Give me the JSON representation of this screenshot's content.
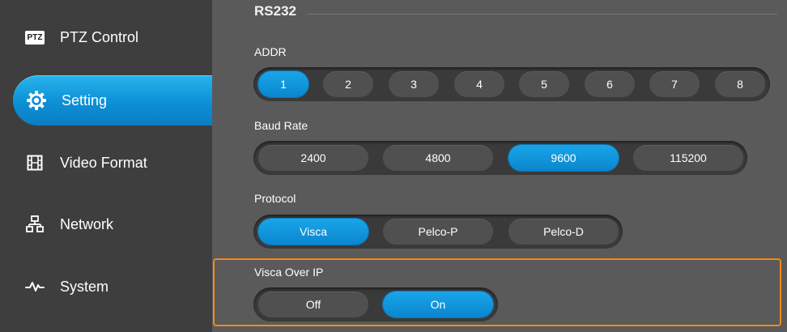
{
  "sidebar": {
    "items": [
      {
        "label": "PTZ Control",
        "icon": "ptz-icon",
        "badge": "PTZ"
      },
      {
        "label": "Setting",
        "icon": "gear-icon"
      },
      {
        "label": "Video Format",
        "icon": "film-icon"
      },
      {
        "label": "Network",
        "icon": "network-icon"
      },
      {
        "label": "System",
        "icon": "pulse-icon"
      }
    ],
    "active": "Setting"
  },
  "main": {
    "section_title": "RS232",
    "addr": {
      "label": "ADDR",
      "options": [
        "1",
        "2",
        "3",
        "4",
        "5",
        "6",
        "7",
        "8"
      ],
      "selected": "1"
    },
    "baud": {
      "label": "Baud Rate",
      "options": [
        "2400",
        "4800",
        "9600",
        "115200"
      ],
      "selected": "9600"
    },
    "protocol": {
      "label": "Protocol",
      "options": [
        "Visca",
        "Pelco-P",
        "Pelco-D"
      ],
      "selected": "Visca"
    },
    "visca_over_ip": {
      "label": "Visca Over IP",
      "options": [
        "Off",
        "On"
      ],
      "selected": "On"
    }
  },
  "colors": {
    "accent": "#0d8fd6",
    "sidebar_bg": "#3e3e3e",
    "content_bg": "#5a5a5a",
    "highlight_border": "#f08a1c"
  }
}
